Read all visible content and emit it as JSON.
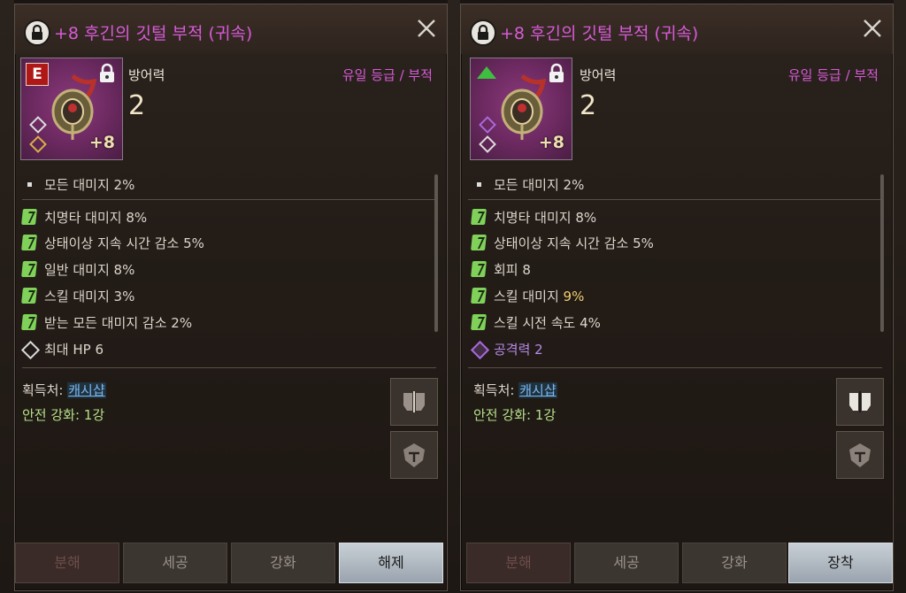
{
  "panels": [
    {
      "title": "+8 후긴의 깃털 부적 (귀속)",
      "stat_label": "방어력",
      "stat_value": "2",
      "grade": "유일 등급 / 부적",
      "tier_badge": "E",
      "enhance": "+8",
      "base_option": "모든 대미지 2%",
      "options": [
        {
          "icon": "green-rune-icon",
          "text": "치명타 대미지 8%"
        },
        {
          "icon": "green-rune-icon",
          "text": "상태이상 지속 시간 감소  5%"
        },
        {
          "icon": "green-rune-icon",
          "text": "일반 대미지 8%"
        },
        {
          "icon": "green-rune-icon",
          "text": "스킬 대미지 3%"
        },
        {
          "icon": "green-rune-icon",
          "text": "받는 모든 대미지 감소  2%"
        },
        {
          "icon": "white-diamond-icon",
          "text": "최대 HP  6"
        }
      ],
      "source_label": "획득처: ",
      "source_link": "캐시샵",
      "safe_enhance": "안전 강화: 1강",
      "buttons": [
        "분해",
        "세공",
        "강화",
        "해제"
      ]
    },
    {
      "title": "+8 후긴의 깃털 부적 (귀속)",
      "stat_label": "방어력",
      "stat_value": "2",
      "grade": "유일 등급 / 부적",
      "enhance": "+8",
      "base_option": "모든 대미지 2%",
      "options": [
        {
          "icon": "green-rune-icon",
          "text": "치명타 대미지 8%"
        },
        {
          "icon": "green-rune-icon",
          "text": "상태이상 지속 시간 감소  5%"
        },
        {
          "icon": "green-rune-icon",
          "text": "회피 8"
        },
        {
          "icon": "green-rune-icon",
          "text_pre": "스킬 대미지 ",
          "text_hl": "9%"
        },
        {
          "icon": "green-rune-icon",
          "text": "스킬 시전 속도  4%"
        },
        {
          "icon": "purple-diamond-icon",
          "text": "공격력  2"
        }
      ],
      "source_label": "획득처: ",
      "source_link": "캐시샵",
      "safe_enhance": "안전 강화: 1강",
      "buttons": [
        "분해",
        "세공",
        "강화",
        "장착"
      ]
    }
  ],
  "colors": {
    "title": "#d85ad8",
    "grade": "#d85ad8",
    "rune_green": "#7fd15a",
    "link": "#7ab8f0",
    "safe_enhance": "#b6e08a",
    "highlight": "#f0d070"
  }
}
